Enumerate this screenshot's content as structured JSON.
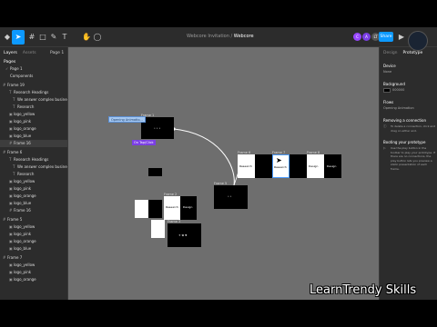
{
  "toolbar": {
    "file_tab": "Webcore",
    "breadcrumb_project": "Webcore Invitation",
    "breadcrumb_sep": "/",
    "breadcrumb_file": "Webcore",
    "share_label": "Share",
    "avatars": [
      "C",
      "A",
      "LT"
    ]
  },
  "sidebar": {
    "tab_layers": "Layers",
    "tab_assets": "Assets",
    "page_selector": "Page 1",
    "pages_heading": "Pages",
    "pages": [
      "Page 1",
      "Components"
    ],
    "layers_heading": "Frame 19",
    "groups": [
      {
        "title": "Frame 19",
        "items": [
          "Research Headings",
          "We answer complex business",
          "Research",
          "logo_yellow",
          "logo_pink",
          "logo_orange",
          "logo_blue",
          "Frame 16"
        ]
      },
      {
        "title": "Frame 6",
        "items": [
          "Research Headings",
          "We answer complex business",
          "Research",
          "logo_yellow",
          "logo_pink",
          "logo_orange",
          "logo_blue",
          "Frame 16"
        ]
      },
      {
        "title": "Frame 5",
        "items": [
          "logo_yellow",
          "logo_pink",
          "logo_orange",
          "logo_blue"
        ]
      },
      {
        "title": "Frame 7",
        "items": [
          "logo_yellow",
          "logo_pink",
          "logo_orange"
        ]
      }
    ]
  },
  "canvas": {
    "frame_top_label": "Frame 1",
    "opening_label": "Opening Animatio...",
    "purple_tag": "On Tap/Click",
    "frame_mid_label": "Frame 5",
    "row_labels": [
      "Frame 6",
      "Frame 7",
      "Frame 8"
    ],
    "card_texts": [
      "Research",
      "Research",
      "Design"
    ],
    "group2_labels": [
      "Frame 2",
      "Frame 3"
    ],
    "group2_texts": [
      "Research",
      "Design"
    ]
  },
  "rpanel": {
    "tab_design": "Design",
    "tab_prototype": "Prototype",
    "device_heading": "Device",
    "device_value": "None",
    "background_heading": "Background",
    "background_value": "000000",
    "flows_heading": "Flows",
    "flow_value": "Opening Animation",
    "removing_heading": "Removing a connection",
    "removing_text": "To delete a connection, click and drag on either end.",
    "booting_heading": "Booting your prototype",
    "booting_text": "Use the play button in the toolbar to play your prototype. If there are no connections, the play button lets you preview a static presentation of each frame."
  },
  "watermark": "LearnTrendy Skills",
  "colors": {
    "accent": "#0d99ff",
    "canvas": "#6e6e6e",
    "panel": "#2c2c2c",
    "purple": "#7b3fe4"
  }
}
